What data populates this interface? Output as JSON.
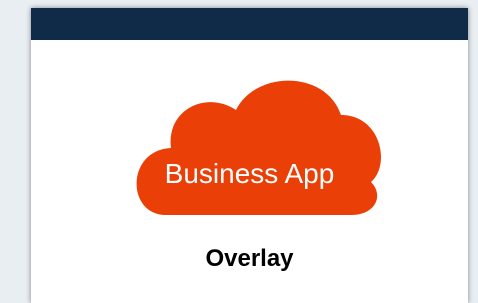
{
  "window": {
    "title_bar_color": "#0f2b48"
  },
  "app_tile": {
    "label": "Business App",
    "cloud_color": "#ea3f07",
    "icon": "cloud-icon"
  },
  "caption": {
    "text": "Overlay"
  }
}
